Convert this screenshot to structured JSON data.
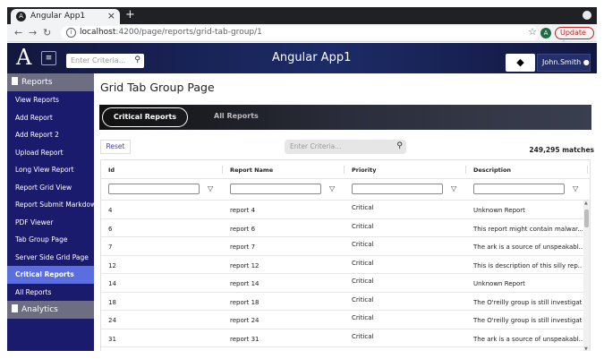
{
  "browser": {
    "tab_title": "Angular App1",
    "tab_close": "×",
    "new_tab": "+",
    "url_host": "localhost",
    "url_path": ":4200/page/reports/grid-tab-group/1",
    "profile_initial": "A",
    "update_label": "Update"
  },
  "header": {
    "logo": "A",
    "search_placeholder": "Enter Criteria...",
    "app_title": "Angular App1",
    "user_label": "John.Smith"
  },
  "sidebar": {
    "sections": [
      {
        "label": "Reports"
      },
      {
        "label": "Analytics"
      }
    ],
    "items": [
      {
        "label": "View Reports"
      },
      {
        "label": "Add Report"
      },
      {
        "label": "Add Report 2"
      },
      {
        "label": "Upload Report"
      },
      {
        "label": "Long View Report"
      },
      {
        "label": "Report Grid View"
      },
      {
        "label": "Report Submit Markdown"
      },
      {
        "label": "PDF Viewer"
      },
      {
        "label": "Tab Group Page"
      },
      {
        "label": "Server Side Grid Page"
      },
      {
        "label": "Critical Reports",
        "active": true
      },
      {
        "label": "All Reports"
      }
    ]
  },
  "main": {
    "page_title": "Grid Tab Group Page",
    "tabs": [
      {
        "label": "Critical Reports",
        "active": true
      },
      {
        "label": "All Reports"
      }
    ],
    "reset_label": "Reset",
    "criteria_placeholder": "Enter Criteria...",
    "match_count": "249,295 matches",
    "columns": [
      "Id",
      "Report Name",
      "Priority",
      "Description"
    ],
    "rows": [
      {
        "id": "4",
        "name": "report 4",
        "priority": "Critical",
        "description": "Unknown Report"
      },
      {
        "id": "6",
        "name": "report 6",
        "priority": "Critical",
        "description": "This report might contain malwar..."
      },
      {
        "id": "7",
        "name": "report 7",
        "priority": "Critical",
        "description": "The ark is a source of unspeakabl..."
      },
      {
        "id": "12",
        "name": "report 12",
        "priority": "Critical",
        "description": "This is description of this silly rep..."
      },
      {
        "id": "14",
        "name": "report 14",
        "priority": "Critical",
        "description": "Unknown Report"
      },
      {
        "id": "18",
        "name": "report 18",
        "priority": "Critical",
        "description": "The O'reilly group is still investigat..."
      },
      {
        "id": "24",
        "name": "report 24",
        "priority": "Critical",
        "description": "The O'reilly group is still investigat..."
      },
      {
        "id": "31",
        "name": "report 31",
        "priority": "Critical",
        "description": "The ark is a source of unspeakabl..."
      }
    ]
  },
  "colors": {
    "sidebar_bg": "#1b1b6e",
    "sidebar_active": "#5a6ee0",
    "header_bg": "#1d2b67",
    "accent_link": "#3b3fbf"
  }
}
